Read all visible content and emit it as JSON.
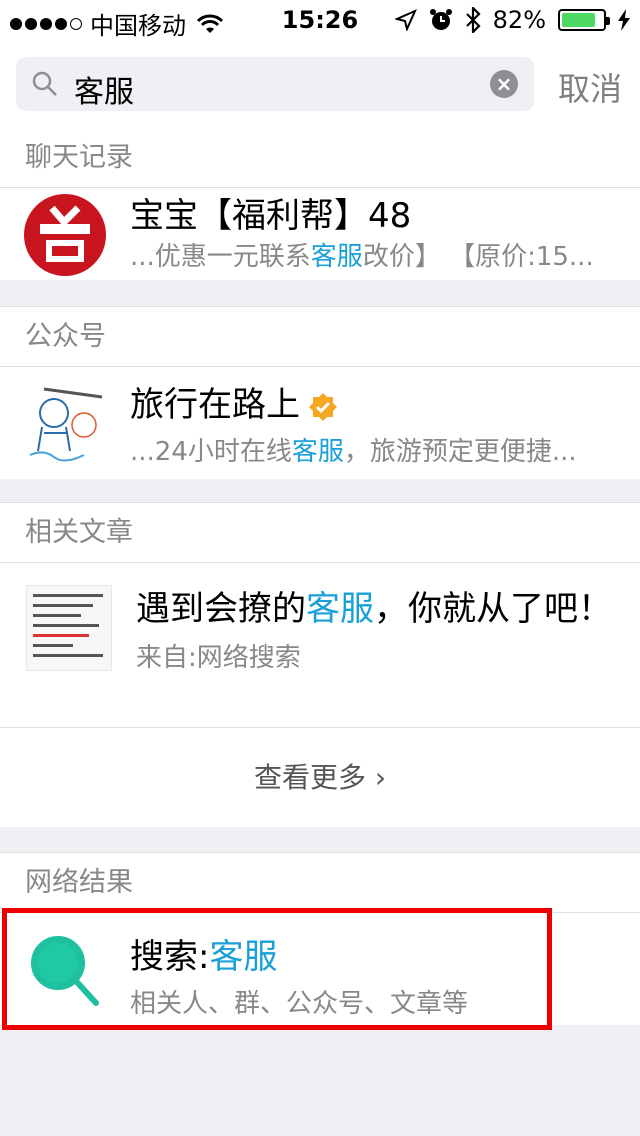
{
  "status_bar": {
    "carrier": "中国移动",
    "time": "15:26",
    "battery_pct": "82%",
    "battery_level": 0.82,
    "signal_dots_filled": 4,
    "signal_dots_total": 5,
    "icons": [
      "wifi-icon",
      "location-icon",
      "alarm-icon",
      "bluetooth-icon",
      "battery-icon"
    ]
  },
  "search": {
    "value": "客服",
    "cancel_label": "取消"
  },
  "chat_records": {
    "header": "聊天记录",
    "item": {
      "title": "宝宝【福利帮】48",
      "snippet_prefix": "...优惠一元联系",
      "snippet_highlight": "客服",
      "snippet_suffix": "改价】 【原价:15..."
    }
  },
  "official_accounts": {
    "header": "公众号",
    "item": {
      "title": "旅行在路上",
      "snippet_prefix": "...24小时在线",
      "snippet_highlight": "客服",
      "snippet_suffix": "，旅游预定更便捷..."
    }
  },
  "articles": {
    "header": "相关文章",
    "item": {
      "title_prefix": "遇到会撩的",
      "title_highlight": "客服",
      "title_suffix": "，你就从了吧！",
      "source": "来自:网络搜索"
    },
    "more_label": "查看更多"
  },
  "web_results": {
    "header": "网络结果",
    "item": {
      "title_prefix": "搜索:",
      "title_highlight": "客服",
      "subtitle": "相关人、群、公众号、文章等"
    }
  },
  "colors": {
    "highlight": "#1aa0d8",
    "search_icon": "#1ec0a0",
    "verified_badge": "#f5a623",
    "selection_box": "#ee0000"
  }
}
